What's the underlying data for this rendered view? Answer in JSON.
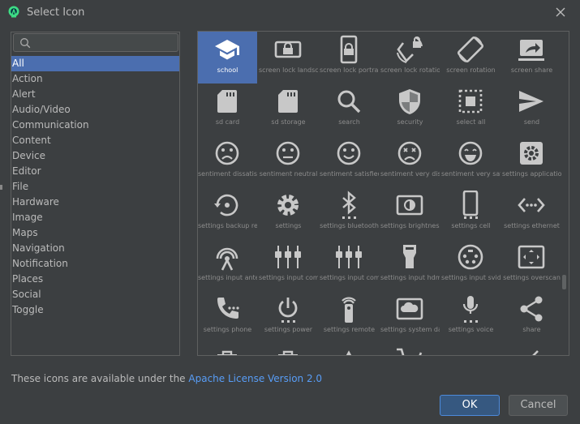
{
  "window": {
    "title": "Select Icon",
    "icon": "android-studio-icon",
    "close_icon": "close-icon"
  },
  "search": {
    "placeholder": "",
    "value": "",
    "icon": "search-icon"
  },
  "categories": [
    "All",
    "Action",
    "Alert",
    "Audio/Video",
    "Communication",
    "Content",
    "Device",
    "Editor",
    "File",
    "Hardware",
    "Image",
    "Maps",
    "Navigation",
    "Notification",
    "Places",
    "Social",
    "Toggle"
  ],
  "selected_category": "All",
  "icons": [
    {
      "label": "school",
      "icon": "school-icon"
    },
    {
      "label": "screen lock landscape",
      "icon": "screen-lock-landscape-icon"
    },
    {
      "label": "screen lock portrait",
      "icon": "screen-lock-portrait-icon"
    },
    {
      "label": "screen lock rotation",
      "icon": "screen-lock-rotation-icon"
    },
    {
      "label": "screen rotation",
      "icon": "screen-rotation-icon"
    },
    {
      "label": "screen share",
      "icon": "screen-share-icon"
    },
    {
      "label": "sd card",
      "icon": "sd-card-icon"
    },
    {
      "label": "sd storage",
      "icon": "sd-storage-icon"
    },
    {
      "label": "search",
      "icon": "search-icon"
    },
    {
      "label": "security",
      "icon": "security-icon"
    },
    {
      "label": "select all",
      "icon": "select-all-icon"
    },
    {
      "label": "send",
      "icon": "send-icon"
    },
    {
      "label": "sentiment dissatisfied",
      "icon": "sentiment-dissatisfied-icon"
    },
    {
      "label": "sentiment neutral",
      "icon": "sentiment-neutral-icon"
    },
    {
      "label": "sentiment satisfied",
      "icon": "sentiment-satisfied-icon"
    },
    {
      "label": "sentiment very dissatisfied",
      "icon": "sentiment-very-dissatisfied-icon"
    },
    {
      "label": "sentiment very satisfied",
      "icon": "sentiment-very-satisfied-icon"
    },
    {
      "label": "settings applications",
      "icon": "settings-applications-icon"
    },
    {
      "label": "settings backup restore",
      "icon": "settings-backup-restore-icon"
    },
    {
      "label": "settings",
      "icon": "settings-icon"
    },
    {
      "label": "settings bluetooth",
      "icon": "settings-bluetooth-icon"
    },
    {
      "label": "settings brightness",
      "icon": "settings-brightness-icon"
    },
    {
      "label": "settings cell",
      "icon": "settings-cell-icon"
    },
    {
      "label": "settings ethernet",
      "icon": "settings-ethernet-icon"
    },
    {
      "label": "settings input antenna",
      "icon": "settings-input-antenna-icon"
    },
    {
      "label": "settings input component",
      "icon": "settings-input-component-icon"
    },
    {
      "label": "settings input composite",
      "icon": "settings-input-composite-icon"
    },
    {
      "label": "settings input hdmi",
      "icon": "settings-input-hdmi-icon"
    },
    {
      "label": "settings input svideo",
      "icon": "settings-input-svideo-icon"
    },
    {
      "label": "settings overscan",
      "icon": "settings-overscan-icon"
    },
    {
      "label": "settings phone",
      "icon": "settings-phone-icon"
    },
    {
      "label": "settings power",
      "icon": "settings-power-icon"
    },
    {
      "label": "settings remote",
      "icon": "settings-remote-icon"
    },
    {
      "label": "settings system daydream",
      "icon": "settings-system-daydream-icon"
    },
    {
      "label": "settings voice",
      "icon": "settings-voice-icon"
    },
    {
      "label": "share",
      "icon": "share-icon"
    },
    {
      "label": "",
      "icon": "shop-icon"
    },
    {
      "label": "",
      "icon": "shop-two-icon"
    },
    {
      "label": "",
      "icon": "signal-icon"
    },
    {
      "label": "",
      "icon": "shopping-cart-icon"
    },
    {
      "label": "",
      "icon": "short-text-icon"
    },
    {
      "label": "",
      "icon": "chevron-icon"
    }
  ],
  "selected_icon": "school",
  "footer": {
    "text": "These icons are available under the ",
    "link": "Apache License Version 2.0"
  },
  "buttons": {
    "ok": "OK",
    "cancel": "Cancel"
  },
  "colors": {
    "background": "#3c3f41",
    "selection": "#4b6eaf",
    "link": "#589df6",
    "icon": "#c8c8c8",
    "label": "#8c8c8c"
  }
}
